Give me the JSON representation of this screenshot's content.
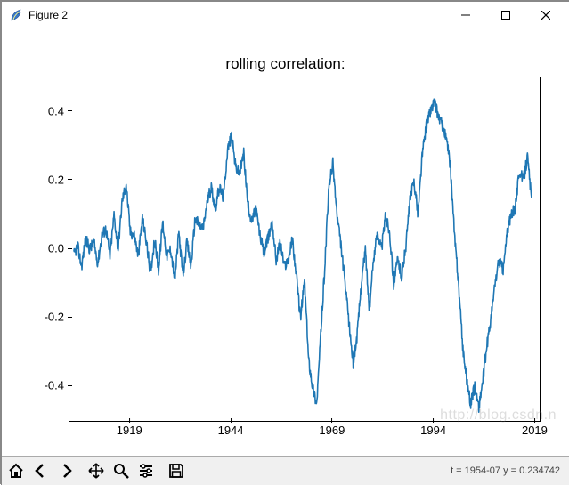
{
  "window": {
    "title": "Figure 2"
  },
  "chart_data": {
    "type": "line",
    "title": "rolling correlation:",
    "xlabel": "",
    "ylabel": "",
    "xlim": [
      1904,
      2020
    ],
    "ylim": [
      -0.5,
      0.5
    ],
    "xticks": [
      1919,
      1944,
      1969,
      1994,
      2019
    ],
    "yticks": [
      -0.4,
      -0.2,
      0.0,
      0.2,
      0.4
    ],
    "x": [
      1905,
      1906,
      1907,
      1908,
      1909,
      1910,
      1911,
      1912,
      1913,
      1914,
      1915,
      1916,
      1917,
      1918,
      1919,
      1920,
      1921,
      1922,
      1923,
      1924,
      1925,
      1926,
      1927,
      1928,
      1929,
      1930,
      1931,
      1932,
      1933,
      1934,
      1935,
      1936,
      1937,
      1938,
      1939,
      1940,
      1941,
      1942,
      1943,
      1944,
      1945,
      1946,
      1947,
      1948,
      1949,
      1950,
      1951,
      1952,
      1953,
      1954,
      1955,
      1956,
      1957,
      1958,
      1959,
      1960,
      1961,
      1962,
      1963,
      1964,
      1965,
      1966,
      1967,
      1968,
      1969,
      1970,
      1971,
      1972,
      1973,
      1974,
      1975,
      1976,
      1977,
      1978,
      1979,
      1980,
      1981,
      1982,
      1983,
      1984,
      1985,
      1986,
      1987,
      1988,
      1989,
      1990,
      1991,
      1992,
      1993,
      1994,
      1995,
      1996,
      1997,
      1998,
      1999,
      2000,
      2001,
      2002,
      2003,
      2004,
      2005,
      2006,
      2007,
      2008,
      2009,
      2010,
      2011,
      2012,
      2013,
      2014,
      2015,
      2016,
      2017,
      2018
    ],
    "values": [
      -0.02,
      0.01,
      -0.05,
      0.03,
      0.0,
      0.02,
      -0.04,
      0.04,
      0.06,
      -0.02,
      0.1,
      0.0,
      0.14,
      0.19,
      0.05,
      0.04,
      -0.02,
      0.09,
      0.02,
      -0.07,
      0.03,
      -0.06,
      0.08,
      -0.02,
      0.0,
      -0.09,
      0.05,
      -0.08,
      0.02,
      -0.05,
      0.09,
      0.07,
      0.06,
      0.14,
      0.18,
      0.12,
      0.18,
      0.15,
      0.29,
      0.33,
      0.24,
      0.22,
      0.28,
      0.13,
      0.08,
      0.12,
      0.04,
      -0.01,
      0.03,
      0.08,
      -0.03,
      0.02,
      -0.05,
      -0.03,
      0.03,
      -0.08,
      -0.2,
      -0.09,
      -0.32,
      -0.4,
      -0.45,
      -0.25,
      -0.05,
      0.18,
      0.25,
      0.1,
      0.01,
      -0.1,
      -0.22,
      -0.33,
      -0.25,
      -0.1,
      0.0,
      -0.18,
      -0.03,
      0.05,
      0.0,
      0.1,
      0.05,
      -0.1,
      -0.03,
      -0.08,
      0.01,
      0.14,
      0.2,
      0.1,
      0.27,
      0.36,
      0.4,
      0.43,
      0.39,
      0.36,
      0.32,
      0.24,
      0.04,
      -0.1,
      -0.28,
      -0.38,
      -0.45,
      -0.4,
      -0.46,
      -0.38,
      -0.28,
      -0.2,
      -0.1,
      -0.03,
      -0.06,
      0.05,
      0.1,
      0.12,
      0.23,
      0.2,
      0.27,
      0.15
    ]
  },
  "toolbar": {
    "status": "t = 1954-07 y = 0.234742"
  },
  "watermark": "http://blog.csdn.n"
}
